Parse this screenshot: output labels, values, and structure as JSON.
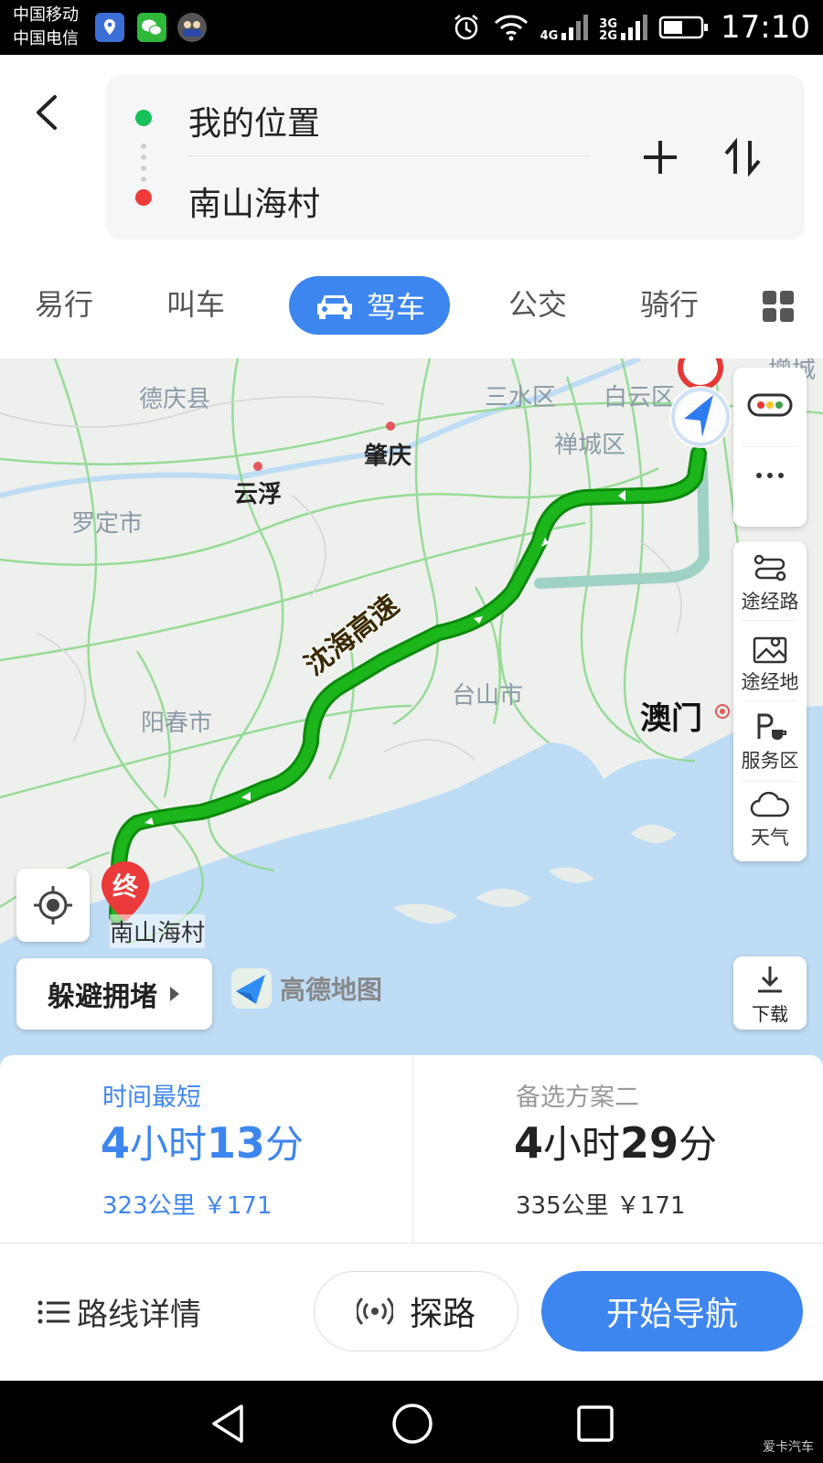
{
  "status_bar": {
    "carrier_1": "中国移动",
    "carrier_2": "中国电信",
    "network_1": "4G",
    "network_2a": "3G",
    "network_2b": "2G",
    "time": "17:10"
  },
  "route_input": {
    "origin": "我的位置",
    "destination": "南山海村"
  },
  "mode_tabs": [
    {
      "label": "易行"
    },
    {
      "label": "叫车"
    },
    {
      "label": "驾车",
      "active": true
    },
    {
      "label": "公交"
    },
    {
      "label": "骑行"
    }
  ],
  "map": {
    "labels": {
      "deqing": "德庆县",
      "zhaoqing": "肇庆",
      "yunfu": "云浮",
      "luoding": "罗定市",
      "sanshui": "三水区",
      "baiyun": "白云区",
      "chancheng": "禅城区",
      "zengcheng": "增城",
      "taishan": "台山市",
      "yangchun": "阳春市",
      "macau": "澳门",
      "expressway": "沈海高速",
      "destination": "南山海村",
      "end_marker": "终"
    },
    "side_tools": {
      "waypoint_route": "途经路",
      "waypoint_place": "途经地",
      "service_area": "服务区",
      "weather": "天气"
    },
    "avoid_congestion": "躲避拥堵",
    "brand": "高德地图",
    "download": "下载"
  },
  "routes": [
    {
      "tag": "时间最短",
      "time_h": "4",
      "time_h_unit": "小时",
      "time_m": "13",
      "time_m_unit": "分",
      "meta": "323公里 ￥171"
    },
    {
      "tag": "备选方案二",
      "time_h": "4",
      "time_h_unit": "小时",
      "time_m": "29",
      "time_m_unit": "分",
      "meta": "335公里 ￥171"
    }
  ],
  "actions": {
    "details": "路线详情",
    "probe": "探路",
    "start": "开始导航"
  },
  "watermark": "爱卡汽车",
  "colors": {
    "accent": "#3d86ef",
    "route_green": "#1cb51c",
    "alt_route": "#9fd1c4",
    "water": "#bfdcf5"
  }
}
